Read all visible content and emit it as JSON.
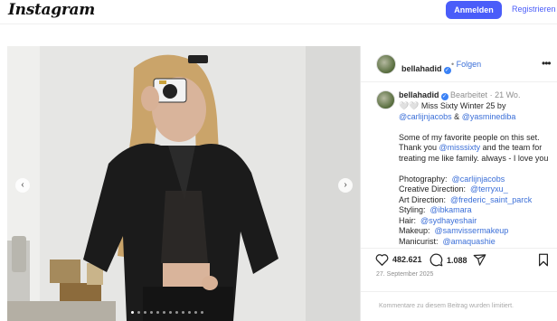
{
  "header": {
    "logo": "Instagram",
    "login_label": "Anmelden",
    "register_label": "Registrieren"
  },
  "post": {
    "username": "bellahadid",
    "follow_label": "Folgen",
    "follow_separator": "•",
    "caption": {
      "username": "bellahadid",
      "edited_label": "Bearbeitet",
      "age_separator": "·",
      "age": "21 Wo.",
      "line1_emoji": "🤍🤍",
      "line1_text": " Miss Sixty Winter 25 by",
      "mention_photographer": "@carlijnjacobs",
      "and": " & ",
      "mention_stylist2": "@yasminediba",
      "para2_a": "Some of my favorite people on this set. Thank you ",
      "mention_brand": "@misssixty",
      "para2_b": " and the team for treating me like family. always - I love you",
      "credits": [
        {
          "role": "Photography:",
          "handle": "@carlijnjacobs"
        },
        {
          "role": "Creative Direction:",
          "handle": "@terryxu_"
        },
        {
          "role": "Art Direction:",
          "handle": "@frederic_saint_parck"
        },
        {
          "role": "Styling:",
          "handle": "@ibkamara"
        },
        {
          "role": "Hair:",
          "handle": "@sydhayeshair"
        },
        {
          "role": "Makeup:",
          "handle": "@samvissermakeup"
        },
        {
          "role": "Manicurist:",
          "handle": "@amaquashie"
        }
      ]
    },
    "likes": "482.621",
    "comments": "1.088",
    "date": "27. September 2025",
    "comments_disabled": "Kommentare zu diesem Beitrag wurden limitiert.",
    "carousel": {
      "count": 12,
      "active_index": 0
    }
  },
  "colors": {
    "accent": "#4a5df9",
    "link": "#3b6fd8",
    "verified": "#3b82f6"
  }
}
